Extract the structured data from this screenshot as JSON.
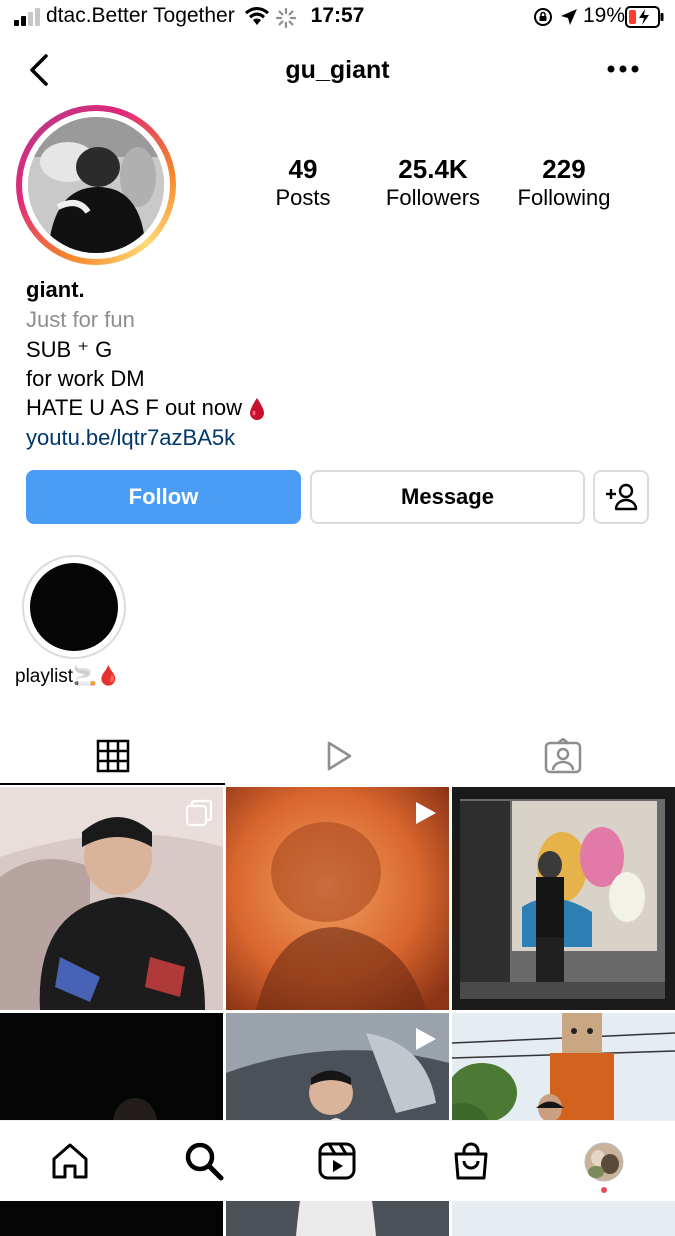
{
  "status_bar": {
    "carrier": "dtac.Better Together",
    "time": "17:57",
    "battery_pct": "19%",
    "battery_color": "#ff3b30"
  },
  "header": {
    "username": "gu_giant",
    "back_icon": "chevron-left-icon",
    "more_icon": "more-horizontal-icon"
  },
  "profile": {
    "stats": [
      {
        "value": "49",
        "label": "Posts"
      },
      {
        "value": "25.4K",
        "label": "Followers"
      },
      {
        "value": "229",
        "label": "Following"
      }
    ],
    "name": "giant.",
    "category": "Just for fun",
    "bio_lines": [
      "SUB ⁺ G",
      "for work DM",
      "HATE U AS F out now"
    ],
    "link": "youtu.be/lqtr7azBA5k"
  },
  "actions": {
    "follow_label": "Follow",
    "message_label": "Message",
    "follow_color": "#4a9cf4"
  },
  "highlights": [
    {
      "label": "playlist🚬🩸"
    }
  ],
  "tabs": [
    {
      "name": "grid",
      "icon": "grid-icon",
      "active": true
    },
    {
      "name": "reels",
      "icon": "reels-play-icon",
      "active": false
    },
    {
      "name": "tagged",
      "icon": "tagged-person-icon",
      "active": false
    }
  ],
  "posts": [
    {
      "type": "carousel",
      "colors": [
        "#c9b8b6",
        "#6b4c48",
        "#1e1b1d"
      ]
    },
    {
      "type": "video",
      "colors": [
        "#e98a4a",
        "#c5552a",
        "#7a2e16"
      ]
    },
    {
      "type": "video",
      "colors": [
        "#3a3a3a",
        "#b8b0a8",
        "#1c1c1c"
      ]
    },
    {
      "type": "photo",
      "colors": [
        "#050505",
        "#0a0a0a",
        "#101010"
      ]
    },
    {
      "type": "video",
      "colors": [
        "#6e7880",
        "#2a2e33",
        "#a8b1b8"
      ]
    },
    {
      "type": "photo",
      "colors": [
        "#e9eef3",
        "#4f7a3a",
        "#c4611f"
      ]
    }
  ],
  "bottom_nav": [
    {
      "name": "home",
      "icon": "home-icon"
    },
    {
      "name": "search",
      "icon": "search-icon"
    },
    {
      "name": "reels",
      "icon": "reels-icon"
    },
    {
      "name": "shop",
      "icon": "shop-bag-icon"
    },
    {
      "name": "profile",
      "icon": "profile-avatar-icon"
    }
  ]
}
